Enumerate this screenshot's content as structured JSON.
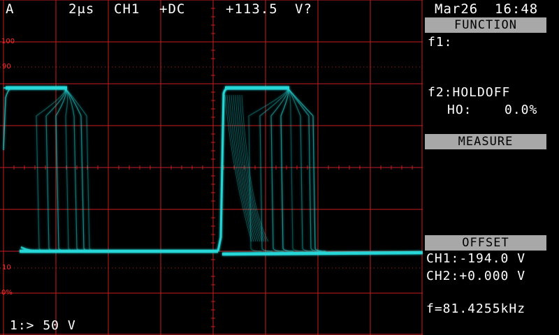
{
  "status_bar": {
    "trigger_mode": "A",
    "timebase": "2μs",
    "channel": "CH1",
    "coupling": "+DC",
    "trigger_level": "+113.5",
    "trigger_unit": "V?"
  },
  "datetime": {
    "date": "Mar26",
    "time": "16:48"
  },
  "grid_labels": {
    "p100": "100",
    "p90": "90",
    "p10": "10",
    "p0": "0%"
  },
  "channel_scale": "1:> 50 V",
  "function_panel": {
    "header": "FUNCTION",
    "f1_label": "f1:",
    "f2_label": "f2:HOLDOFF",
    "holdoff_label": "HO:",
    "holdoff_value": "0.0%"
  },
  "measure_panel": {
    "header": "MEASURE"
  },
  "offset_panel": {
    "header": "OFFSET",
    "ch1": "CH1:-194.0 V",
    "ch2": "CH2:+0.000 V"
  },
  "frequency": "f=81.4255kHz",
  "colors": {
    "background": "#000000",
    "grid": "#c81e1e",
    "trace": "#26d9d9",
    "panel_header": "#a8a8a8",
    "text": "#ffffff"
  },
  "icons": {
    "ch1_marker": "arrow-marker"
  }
}
